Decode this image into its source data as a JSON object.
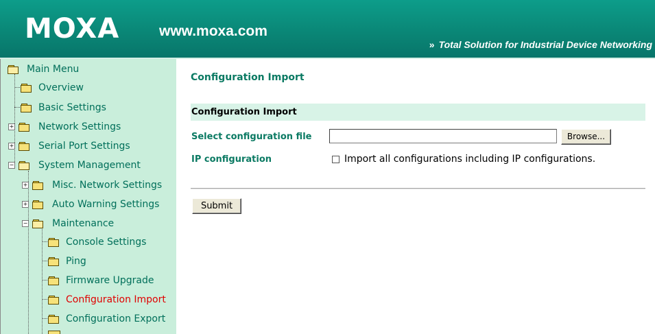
{
  "header": {
    "logo": "MOXA",
    "site": "www.moxa.com",
    "tagline": "Total Solution for Industrial Device Networking",
    "tagline_marker": "»"
  },
  "menu": {
    "root": "Main Menu",
    "items": [
      {
        "label": "Overview"
      },
      {
        "label": "Basic Settings"
      },
      {
        "label": "Network Settings"
      },
      {
        "label": "Serial Port Settings"
      },
      {
        "label": "System Management"
      },
      {
        "label": "Misc. Network Settings"
      },
      {
        "label": "Auto Warning Settings"
      },
      {
        "label": "Maintenance"
      },
      {
        "label": "Console Settings"
      },
      {
        "label": "Ping"
      },
      {
        "label": "Firmware Upgrade"
      },
      {
        "label": "Configuration Import"
      },
      {
        "label": "Configuration Export"
      }
    ],
    "expander_plus": "+",
    "expander_minus": "−"
  },
  "page": {
    "title": "Configuration Import",
    "section_title": "Configuration Import",
    "file_label": "Select configuration file",
    "file_value": "",
    "browse_label": "Browse...",
    "ip_label": "IP configuration",
    "checkbox_label": "Import all configurations including IP configurations.",
    "checkbox_checked": false,
    "submit_label": "Submit"
  },
  "colors": {
    "header_bg": "#0a8a7a",
    "sidebar_bg": "#c9eedb",
    "menu_text": "#006f5a",
    "active_text": "#e00000",
    "label_text": "#0b7a63",
    "section_bar": "#d8f3e7"
  }
}
